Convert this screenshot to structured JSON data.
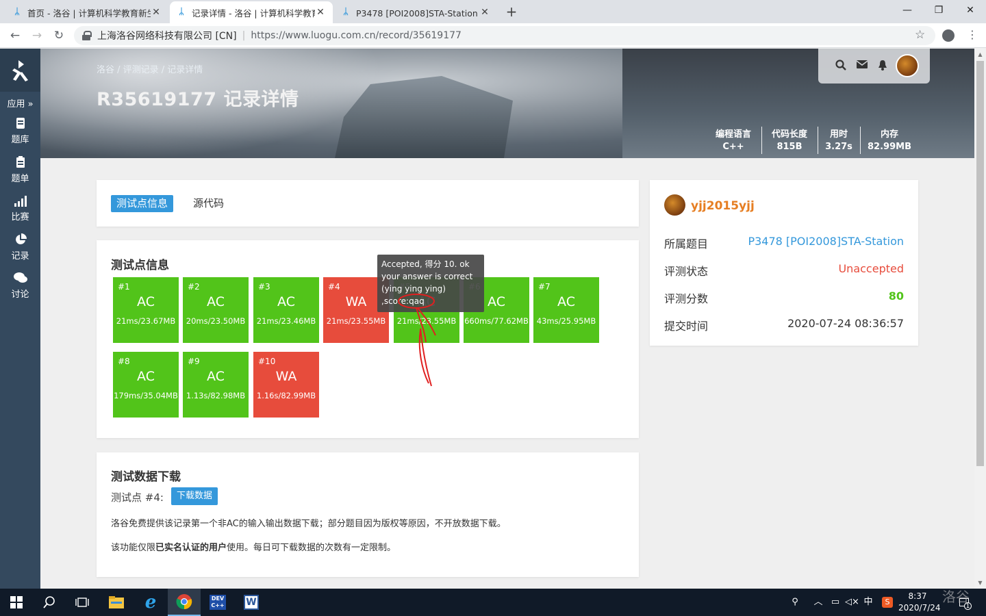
{
  "browser": {
    "tabs": [
      {
        "title": "首页 - 洛谷 | 计算机科学教育新生",
        "active": false
      },
      {
        "title": "记录详情 - 洛谷 | 计算机科学教育新",
        "active": true
      },
      {
        "title": "P3478 [POI2008]STA-Station - 洛谷",
        "active": false
      }
    ],
    "org": "上海洛谷网络科技有限公司 [CN]",
    "url": "https://www.luogu.com.cn/record/35619177"
  },
  "sidebar": {
    "apps_label": "应用",
    "items": [
      {
        "label": "题库",
        "icon": "book-icon"
      },
      {
        "label": "题单",
        "icon": "clipboard-icon"
      },
      {
        "label": "比赛",
        "icon": "bar-chart-icon"
      },
      {
        "label": "记录",
        "icon": "pie-chart-icon"
      },
      {
        "label": "讨论",
        "icon": "comments-icon"
      }
    ]
  },
  "banner": {
    "breadcrumb": "洛谷 / 评测记录 / 记录详情",
    "title": "R35619177 记录详情",
    "stats": [
      {
        "label": "编程语言",
        "value": "C++"
      },
      {
        "label": "代码长度",
        "value": "815B"
      },
      {
        "label": "用时",
        "value": "3.27s"
      },
      {
        "label": "内存",
        "value": "82.99MB"
      }
    ]
  },
  "tabs_card": {
    "tabs": [
      {
        "label": "测试点信息",
        "active": true
      },
      {
        "label": "源代码",
        "active": false
      }
    ]
  },
  "testcases": {
    "title": "测试点信息",
    "cases": [
      {
        "num": "#1",
        "status": "AC",
        "detail": "21ms/23.67MB"
      },
      {
        "num": "#2",
        "status": "AC",
        "detail": "20ms/23.50MB"
      },
      {
        "num": "#3",
        "status": "AC",
        "detail": "21ms/23.46MB"
      },
      {
        "num": "#4",
        "status": "WA",
        "detail": "21ms/23.55MB"
      },
      {
        "num": "#5",
        "status": "AC",
        "detail": "21ms/23.55MB"
      },
      {
        "num": "#6",
        "status": "AC",
        "detail": "660ms/77.62MB"
      },
      {
        "num": "#7",
        "status": "AC",
        "detail": "43ms/25.95MB"
      },
      {
        "num": "#8",
        "status": "AC",
        "detail": "179ms/35.04MB"
      },
      {
        "num": "#9",
        "status": "AC",
        "detail": "1.13s/82.98MB"
      },
      {
        "num": "#10",
        "status": "WA",
        "detail": "1.16s/82.99MB"
      }
    ],
    "tooltip_lines": [
      "Accepted, 得分 10. ok",
      "your answer is correct",
      "(ying ying ying)",
      ",score:qaq"
    ]
  },
  "download": {
    "title": "测试数据下载",
    "case_label": "测试点 #4:",
    "button": "下载数据",
    "note1": "洛谷免费提供该记录第一个非AC的输入输出数据下载；部分题目因为版权等原因，不开放数据下载。",
    "note2_prefix": "该功能仅限",
    "note2_bold": "已实名认证的用户",
    "note2_suffix": "使用。每日可下载数据的次数有一定限制。"
  },
  "info": {
    "username": "yjj2015yjj",
    "rows": [
      {
        "key": "所属题目",
        "value": "P3478 [POI2008]STA-Station",
        "color": "#3498db"
      },
      {
        "key": "评测状态",
        "value": "Unaccepted",
        "color": "#e74c3c"
      },
      {
        "key": "评测分数",
        "value": "80",
        "color": "#52c41a"
      },
      {
        "key": "提交时间",
        "value": "2020-07-24 08:36:57",
        "color": "#333333"
      }
    ]
  },
  "taskbar": {
    "time": "8:37",
    "date": "2020/7/24",
    "ime": "中",
    "notif_count": "1",
    "watermark": "洛谷"
  }
}
